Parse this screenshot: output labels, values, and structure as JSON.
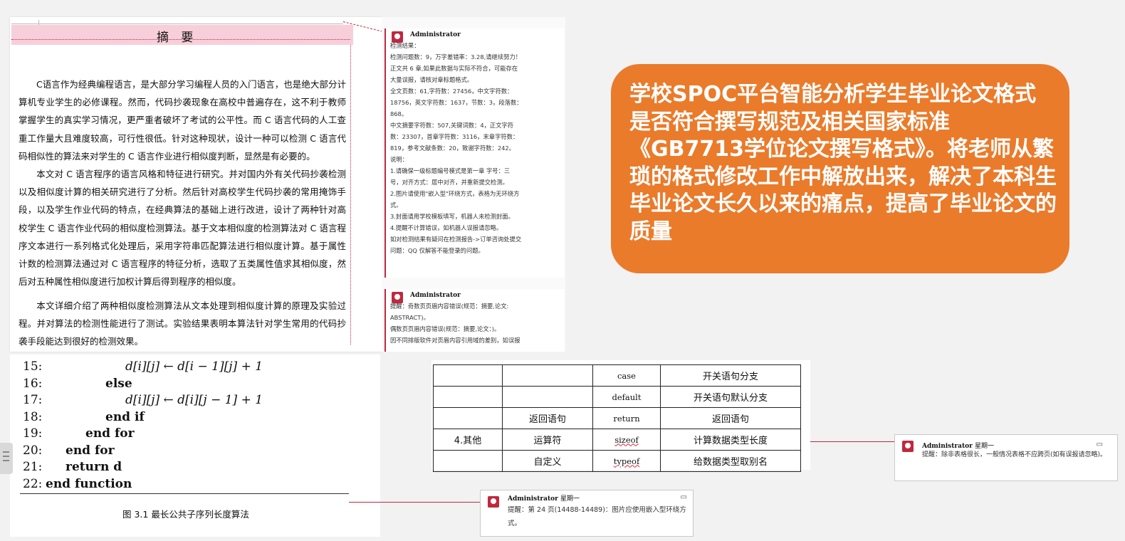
{
  "abstract_page": {
    "title": "摘 要",
    "paragraphs": [
      "C语言作为经典编程语言，是大部分学习编程人员的入门语言，也是绝大部分计算机专业学生的必修课程。然而，代码抄袭现象在高校中普遍存在，这不利于教师掌握学生的真实学习情况，更严重者破坏了考试的公平性。而 C 语言代码的人工查重工作量大且难度较高，可行性很低。针对这种现状，设计一种可以检测 C 语言代码相似性的算法来对学生的 C 语言作业进行相似度判断，显然是有必要的。",
      "本文对 C 语言程序的语言风格和特征进行研究。并对国内外有关代码抄袭检测以及相似度计算的相关研究进行了分析。然后针对高校学生代码抄袭的常用掩饰手段，以及学生作业代码的特点，在经典算法的基础上进行改进，设计了两种针对高校学生 C 语言作业代码的相似度检测算法。基于文本相似度的检测算法对 C 语言程序文本进行一系列格式化处理后，采用字符串匹配算法进行相似度计算。基于属性计数的检测算法通过对 C 语言程序的特征分析，选取了五类属性值求其相似度，然后对五种属性相似度进行加权计算后得到程序的相似度。",
      "本文详细介绍了两种相似度检测算法从文本处理到相似度计算的原理及实验过程。并对算法的检测性能进行了测试。实验结果表明本算法针对学生常用的代码抄袭手段能达到很好的检测效果。"
    ]
  },
  "comment_1": {
    "author": "Administrator",
    "lines": [
      "检测结果：",
      "检测问题数：9，万字差错率：3.28,请继续努力！",
      "正文共 6 章,如果此数据与实际不符合，可能存在",
      "大量误报，请核对章标题格式。",
      "全文页数：61,字符数：27456，中文字符数：",
      "18756，英文字符数：1637，节数：3，段落数：",
      "868。",
      "中文摘要字符数：507,关键词数：4，正文字符",
      "数：23307，首章字符数：3116，末章字符数：",
      "819，参考文献条数：20，致谢字符数：242。",
      "说明：",
      "1.请确保一级标题编号模式是第一章      字号：三",
      "号，对齐方式：居中对齐，并重新提交检测。",
      "2.图片请使用\"嵌入型\"环绕方式，表格为无环绕方",
      "式。",
      "3.封面请用学校模板填写，机器人未检测封面。",
      "4.提醒不计算错误，如机器人误报请忽略。",
      "如对检测结果有疑问在检测报告->订单咨询处提交",
      "问题：QQ 仅解答不能登录的问题。"
    ]
  },
  "comment_2": {
    "author": "Administrator",
    "lines": [
      "提醒：奇数页页眉内容错误(规范：摘要,论文:",
      "ABSTRACT)。",
      "偶数页页眉内容错误(规范：摘要,论文：)。",
      "因不同排版软件对页眉内容引用域的差别，如误报"
    ]
  },
  "callout": {
    "text": "学校SPOC平台智能分析学生毕业论文格式是否符合撰写规范及相关国家标准《GB7713学位论文撰写格式》。将老师从繁琐的格式修改工作中解放出来，解决了本科生毕业论文长久以来的痛点，提高了毕业论文的质量"
  },
  "algorithm": {
    "lines": [
      {
        "num": "15:",
        "code": "d[i][j] ← d[i − 1][j] + 1",
        "kind": "math",
        "indent": 3
      },
      {
        "num": "16:",
        "code": "else",
        "kind": "kw",
        "indent": 2
      },
      {
        "num": "17:",
        "code": "d[i][j] ← d[i][j − 1] + 1",
        "kind": "math",
        "indent": 3
      },
      {
        "num": "18:",
        "code": "end if",
        "kind": "kw",
        "indent": 2
      },
      {
        "num": "19:",
        "code": "end for",
        "kind": "kw",
        "indent": 1
      },
      {
        "num": "20:",
        "code": "end for",
        "kind": "kw",
        "indent": 0
      },
      {
        "num": "21:",
        "code": "return d",
        "kind": "kwmath",
        "indent": 0
      },
      {
        "num": "22:",
        "code": "end function",
        "kind": "kw",
        "indent": -1
      }
    ],
    "caption": "图 3.1  最长公共子序列长度算法"
  },
  "table": {
    "rows": [
      [
        "",
        "",
        "case",
        "开关语句分支"
      ],
      [
        "",
        "",
        "default",
        "开关语句默认分支"
      ],
      [
        "",
        "返回语句",
        "return",
        "返回语句"
      ],
      [
        "4.其他",
        "运算符",
        "sizeof",
        "计算数据类型长度"
      ],
      [
        "",
        "自定义",
        "typeof",
        "给数据类型取别名"
      ]
    ]
  },
  "comment_3": {
    "author": "Administrator",
    "time": "星期一",
    "text": "提醒：除非表格很长，一般情况表格不应跨页(如有误报请忽略)。"
  },
  "comment_4": {
    "author": "Administrator",
    "time": "星期一",
    "text": "提醒：第 24 页(14488-14489)：图片应使用嵌入型环绕方式。"
  },
  "colors": {
    "callout": "#ea7b2b",
    "comment_accent": "#c0283f",
    "title_highlight": "#f7cfdb"
  }
}
